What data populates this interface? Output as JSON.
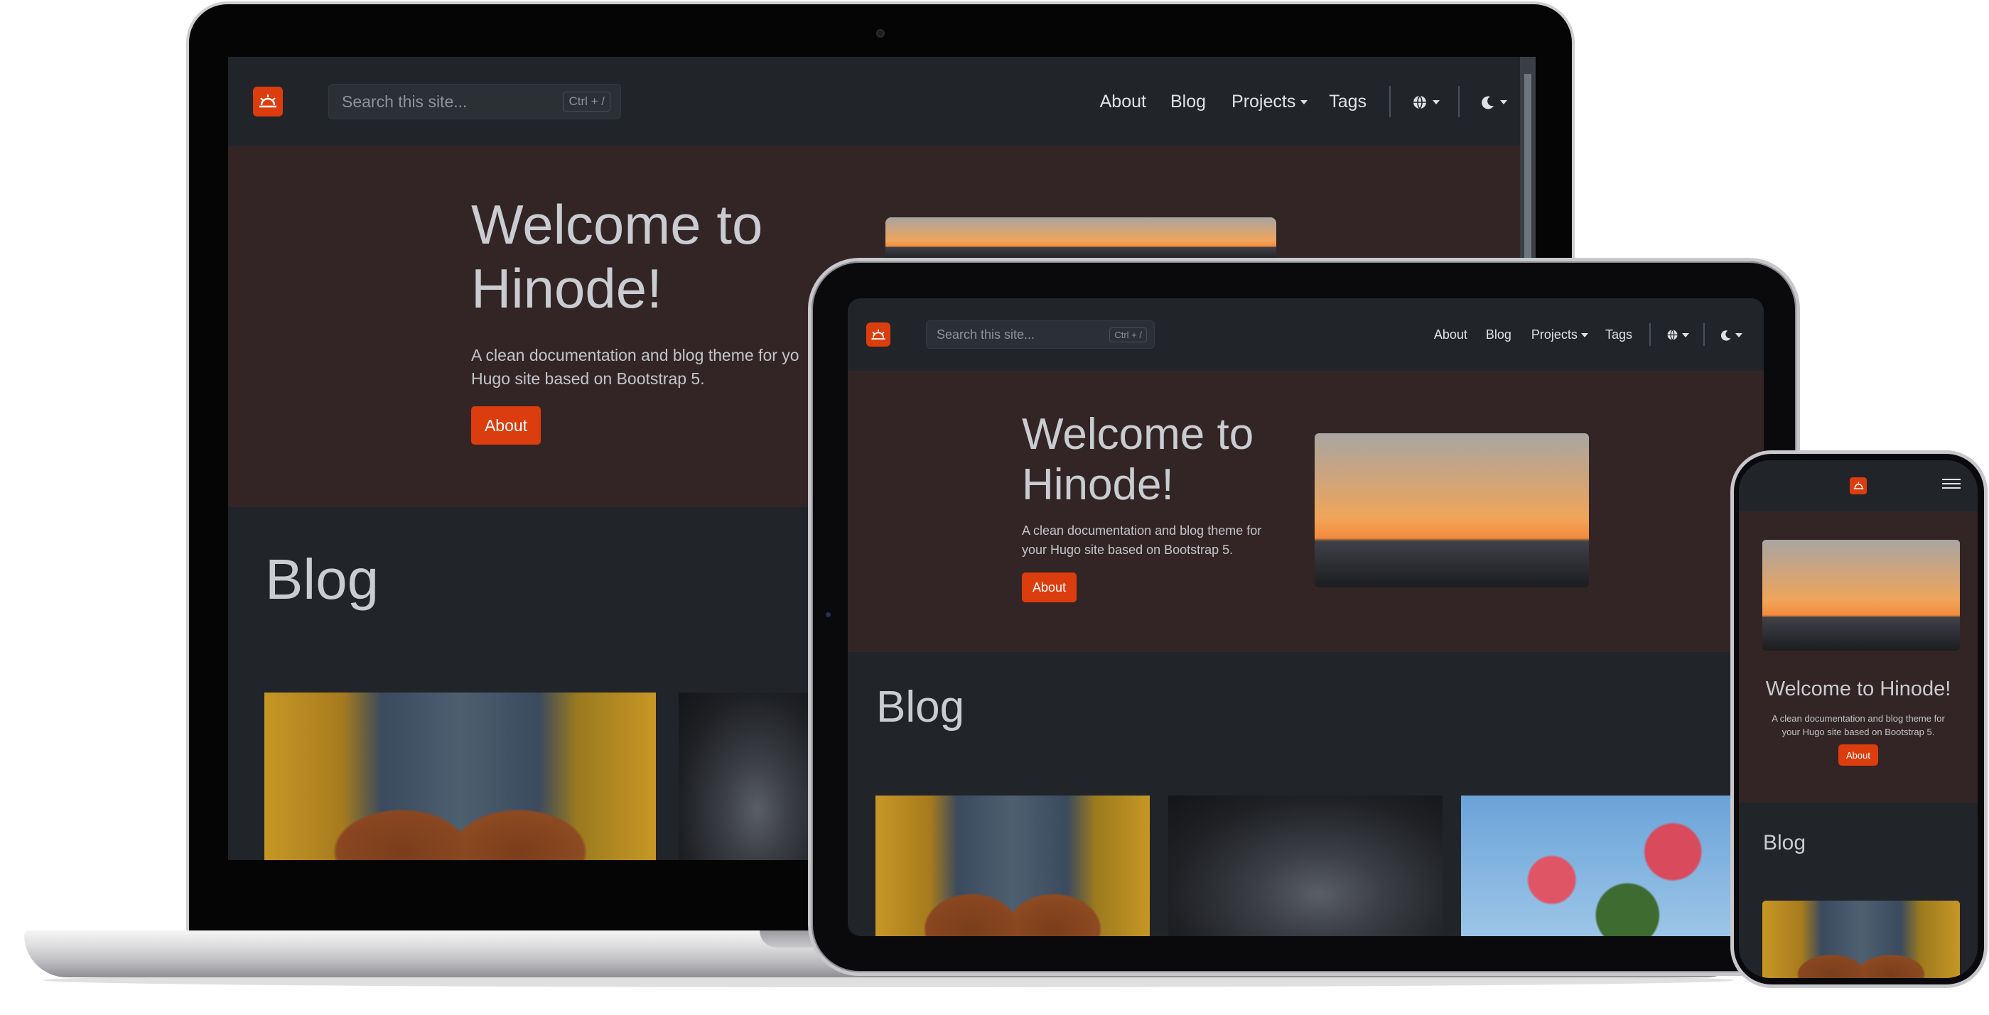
{
  "site": {
    "search_placeholder": "Search this site...",
    "search_shortcut": "Ctrl + /",
    "nav": {
      "about": "About",
      "blog": "Blog",
      "projects": "Projects",
      "tags": "Tags"
    },
    "hero": {
      "title_line1": "Welcome to",
      "title_line2": "Hinode!",
      "title_full": "Welcome to Hinode!",
      "subtitle_line1": "A clean documentation and blog theme for your",
      "subtitle_line2": "Hugo site based on Bootstrap 5.",
      "subtitle_short1": "A clean documentation and blog theme for",
      "subtitle_short2": "your Hugo site based on Bootstrap 5.",
      "subtitle_laptop1": "A clean documentation and blog theme for yo",
      "button": "About"
    },
    "blog_heading": "Blog"
  },
  "icons": {
    "logo": "sunrise-logo-icon",
    "language": "globe-icon",
    "theme": "moon-icon",
    "menu": "hamburger-menu-icon"
  },
  "colors": {
    "brand": "#dc3d0e",
    "navbar": "#212529",
    "hero_bg": "#332526",
    "page_bg": "#212529"
  }
}
